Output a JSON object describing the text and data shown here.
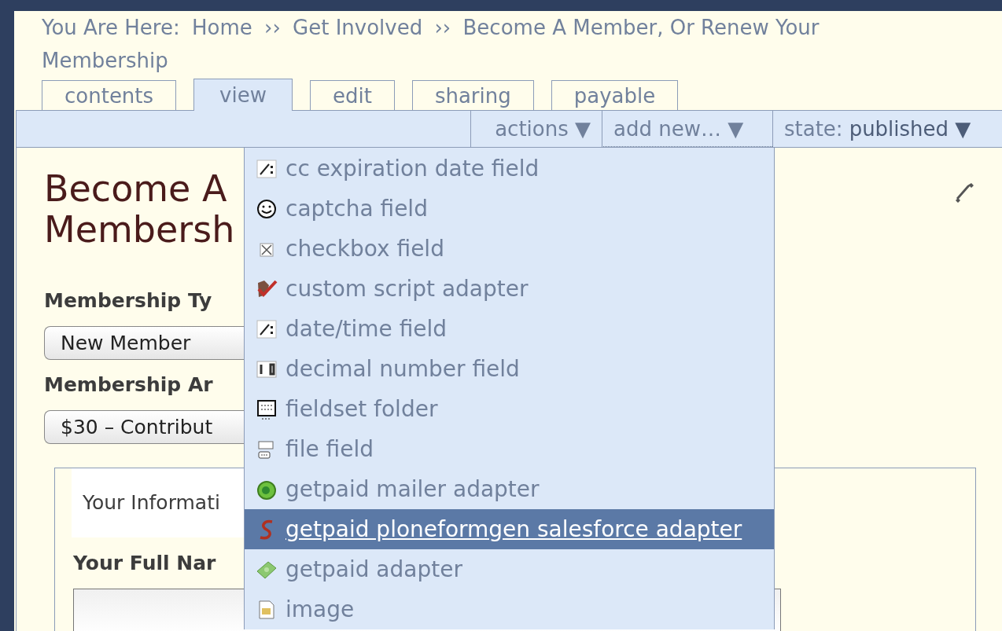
{
  "breadcrumb": {
    "label": "You Are Here:",
    "items": [
      {
        "text": "Home",
        "separator": "››"
      },
      {
        "text": "Get Involved",
        "separator": "››"
      },
      {
        "text": "Become A Member, Or Renew Your Membership"
      }
    ]
  },
  "tabs": [
    {
      "label": "contents",
      "selected": false
    },
    {
      "label": "view",
      "selected": true
    },
    {
      "label": "edit",
      "selected": false
    },
    {
      "label": "sharing",
      "selected": false
    },
    {
      "label": "payable",
      "selected": false
    }
  ],
  "action_bar": {
    "actions": "actions ▼",
    "add_new": "add new… ▼",
    "state_label": "state:",
    "state_value": "published ▼"
  },
  "heading": [
    "Become A",
    "Membersh"
  ],
  "fields": [
    {
      "label": "Membership Ty",
      "value": "New Member"
    },
    {
      "label": "Membership Ar",
      "value": "$30 – Contribut"
    }
  ],
  "fieldset": {
    "legend": "Your Informati",
    "label": "Your Full Nar"
  },
  "menu": [
    {
      "kind": "date",
      "label": "cc expiration date field",
      "selected": false
    },
    {
      "kind": "captcha",
      "label": "captcha field",
      "selected": false
    },
    {
      "kind": "checkbox",
      "label": "checkbox field",
      "selected": false
    },
    {
      "kind": "script",
      "label": "custom script adapter",
      "selected": false
    },
    {
      "kind": "date",
      "label": "date/time field",
      "selected": false
    },
    {
      "kind": "decimal",
      "label": "decimal number field",
      "selected": false
    },
    {
      "kind": "fieldset",
      "label": "fieldset folder",
      "selected": false
    },
    {
      "kind": "file",
      "label": "file field",
      "selected": false
    },
    {
      "kind": "mailer",
      "label": "getpaid mailer adapter",
      "selected": false
    },
    {
      "kind": "salesforce",
      "label": "getpaid ploneformgen salesforce adapter",
      "selected": true
    },
    {
      "kind": "adapter",
      "label": "getpaid adapter",
      "selected": false
    },
    {
      "kind": "image",
      "label": "image",
      "selected": false
    }
  ]
}
